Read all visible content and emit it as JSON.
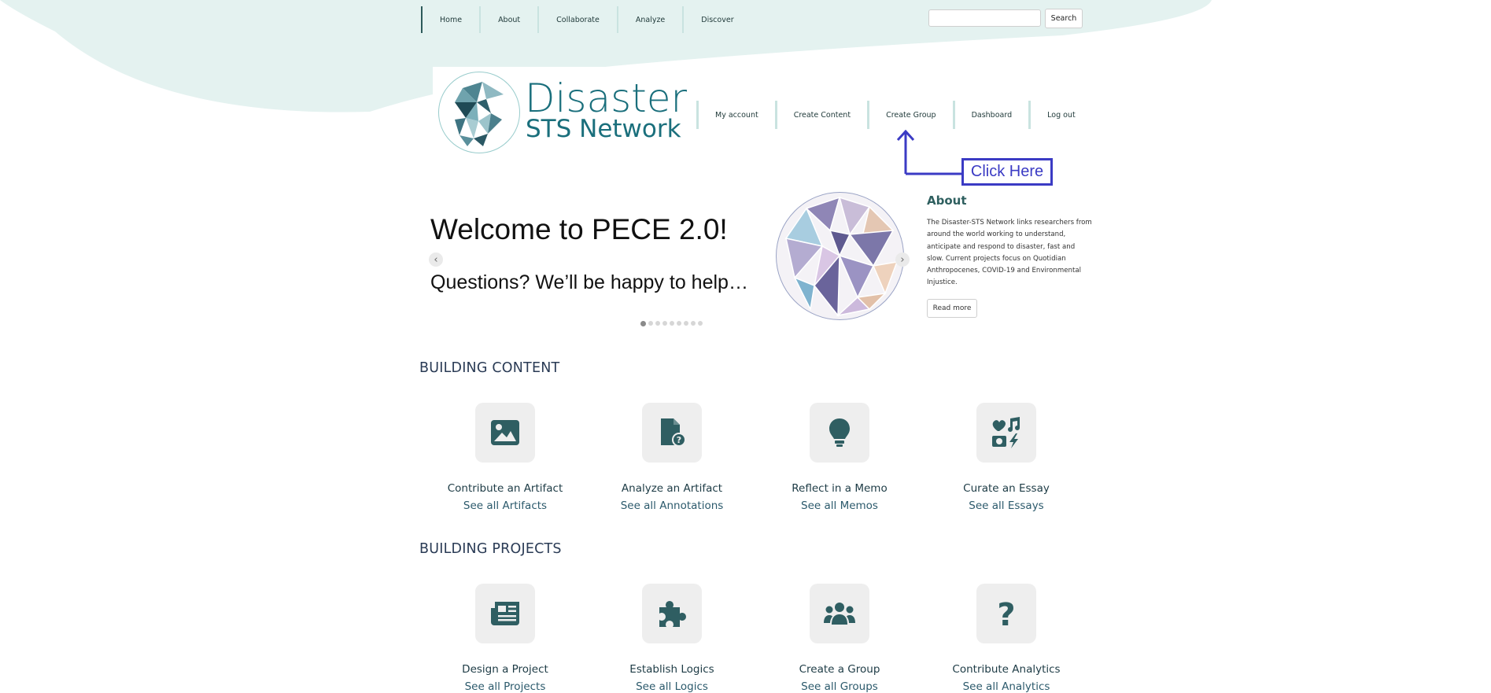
{
  "top_nav": {
    "items": [
      "Home",
      "About",
      "Collaborate",
      "Analyze",
      "Discover"
    ],
    "active": "Home"
  },
  "search": {
    "placeholder": "",
    "button_label": "Search"
  },
  "logo": {
    "title": "Disaster",
    "subtitle": "STS Network"
  },
  "user_nav": {
    "items": [
      "My account",
      "Create Content",
      "Create Group",
      "Dashboard",
      "Log out"
    ]
  },
  "annotation": {
    "label": "Click Here",
    "color": "#3b3bc4"
  },
  "slideshow": {
    "heading": "Welcome to PECE 2.0!",
    "subheading": "Questions? We’ll be happy to help…",
    "slide_count": 9,
    "active_slide": 1
  },
  "about": {
    "heading": "About",
    "lines": [
      "The Disaster-STS Network links researchers from",
      "around the world working to understand,",
      "anticipate and respond to disaster, fast and",
      "slow.  Current projects focus on Quotidian",
      "Anthropocenes, COVID-19 and Environmental",
      "Injustice."
    ],
    "read_more": "Read more"
  },
  "building_content": {
    "heading": "BUILDING CONTENT",
    "cards": [
      {
        "icon": "image-icon",
        "title": "Contribute an Artifact",
        "link": "See all Artifacts"
      },
      {
        "icon": "file-question-icon",
        "title": "Analyze an Artifact",
        "link": "See all Annotations"
      },
      {
        "icon": "lightbulb-icon",
        "title": "Reflect in a Memo",
        "link": "See all Memos"
      },
      {
        "icon": "media-collage-icon",
        "title": "Curate an Essay",
        "link": "See all Essays"
      }
    ]
  },
  "building_projects": {
    "heading": "BUILDING PROJECTS",
    "cards": [
      {
        "icon": "newspaper-icon",
        "title": "Design a Project",
        "link": "See all Projects"
      },
      {
        "icon": "puzzle-piece-icon",
        "title": "Establish Logics",
        "link": "See all Logics"
      },
      {
        "icon": "users-icon",
        "title": "Create a Group",
        "link": "See all Groups"
      },
      {
        "icon": "question-mark-icon",
        "title": "Contribute Analytics",
        "link": "See all Analytics"
      }
    ]
  },
  "colors": {
    "brand_teal": "#1a6f7c",
    "icon_teal": "#2f5e62",
    "wave_bg": "#e4f2f0"
  }
}
